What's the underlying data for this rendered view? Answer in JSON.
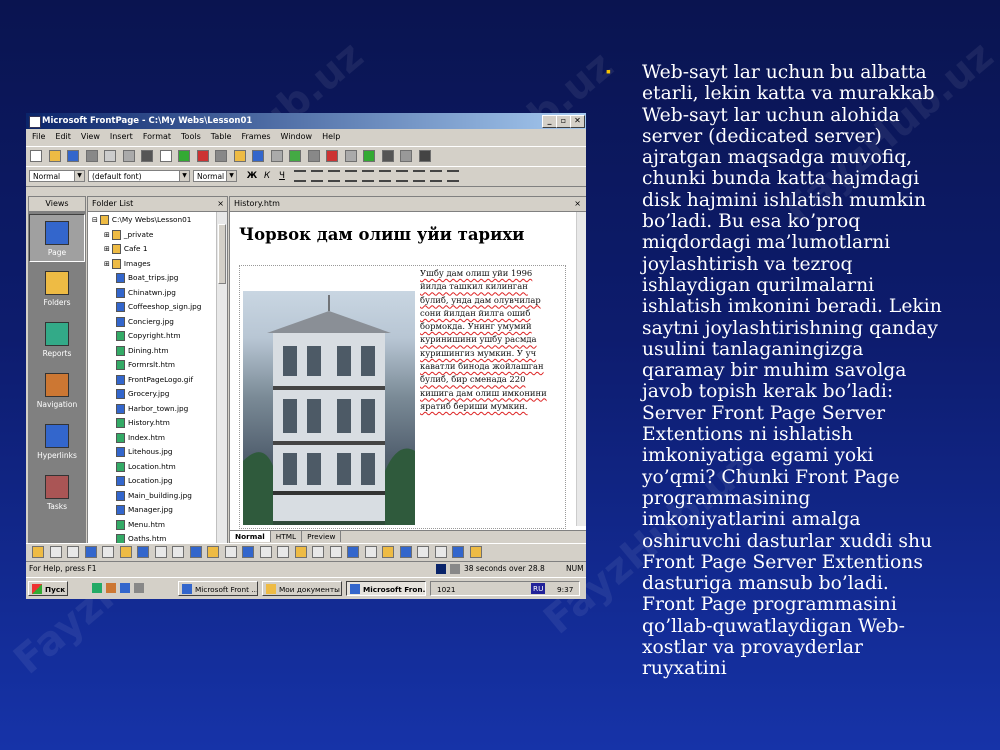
{
  "window": {
    "title": "Microsoft FrontPage - C:\\My Webs\\Lesson01",
    "controls": [
      "_",
      "▫",
      "✕"
    ]
  },
  "menu": [
    "File",
    "Edit",
    "View",
    "Insert",
    "Format",
    "Tools",
    "Table",
    "Frames",
    "Window",
    "Help"
  ],
  "format_toolbar": {
    "style": "Normal",
    "font": "(default font)",
    "size": "Normal",
    "bold": "Ж",
    "italic": "К",
    "underline": "Ч"
  },
  "views_panel": {
    "title": "Views",
    "items": [
      "Page",
      "Folders",
      "Reports",
      "Navigation",
      "Hyperlinks",
      "Tasks"
    ]
  },
  "folder_list": {
    "title": "Folder List",
    "close": "×",
    "items": [
      {
        "label": "C:\\My Webs\\Lesson01",
        "kind": "root"
      },
      {
        "label": "_private",
        "kind": "folder"
      },
      {
        "label": "Cafe 1",
        "kind": "folder"
      },
      {
        "label": "Images",
        "kind": "folder"
      },
      {
        "label": "Boat_trips.jpg",
        "kind": "image"
      },
      {
        "label": "Chinatwn.jpg",
        "kind": "image"
      },
      {
        "label": "Coffeeshop_sign.jpg",
        "kind": "image"
      },
      {
        "label": "Concierg.jpg",
        "kind": "image"
      },
      {
        "label": "Copyright.htm",
        "kind": "page"
      },
      {
        "label": "Dining.htm",
        "kind": "page"
      },
      {
        "label": "Formrslt.htm",
        "kind": "page"
      },
      {
        "label": "FrontPageLogo.gif",
        "kind": "image"
      },
      {
        "label": "Grocery.jpg",
        "kind": "image"
      },
      {
        "label": "Harbor_town.jpg",
        "kind": "image"
      },
      {
        "label": "History.htm",
        "kind": "page"
      },
      {
        "label": "Index.htm",
        "kind": "page"
      },
      {
        "label": "Litehous.jpg",
        "kind": "image"
      },
      {
        "label": "Location.htm",
        "kind": "page"
      },
      {
        "label": "Location.jpg",
        "kind": "image"
      },
      {
        "label": "Main_building.jpg",
        "kind": "image"
      },
      {
        "label": "Manager.jpg",
        "kind": "image"
      },
      {
        "label": "Menu.htm",
        "kind": "page"
      },
      {
        "label": "Oaths.htm",
        "kind": "page"
      }
    ]
  },
  "editor": {
    "tab": "History.htm",
    "close": "×",
    "heading": "Чорвок дам олиш уйи тарихи",
    "body_lines": [
      "Ушбу дам олиш уйи 1996",
      "йилда ташкил килинган",
      "булиб, унда дам олувчилар",
      "сони йилдан йилга ошиб",
      "бормокда. Унинг умумий",
      "куринишини ушбу расмда",
      "куришингиз мумкин. У уч",
      "каватли бинода жойлашган",
      "булиб, бир сменада 220",
      "кишига дам олиш имконини",
      "яратиб бериши мумкин."
    ],
    "modes": [
      "Normal",
      "HTML",
      "Preview"
    ],
    "active_mode": "Normal"
  },
  "status": {
    "help": "For Help, press F1",
    "timing": "38 seconds over 28.8",
    "num": "NUM"
  },
  "taskbar": {
    "start": "Пуск",
    "tasks": [
      "Microsoft Front ...",
      "Мои документы",
      "Microsoft Fron..."
    ],
    "number": "1021",
    "lang": "RU",
    "clock": "9:37"
  },
  "slide_text": "Web-sayt lar uchun bu albatta etarli, lekin katta va murakkab Web-sayt lar uchun alohida server (dedicated server) ajratgan maqsadga muvofiq, chunki bunda katta hajmdagi disk hajmini ishlatish mumkin bo’ladi. Bu esa ko’proq miqdordagi ma’lumotlarni joylashtirish va tezroq ishlaydigan qurilmalarni ishlatish imkonini beradi. Lekin saytni joylashtirishning qanday usulini tanlaganingizga qaramay bir muhim savolga javob topish kerak bo’ladi: Server Front Page Server Extentions ni ishlatish imkoniyatiga egami yoki yo’qmi? Chunki Front Page programmasining imkoniyatlarini amalga oshiruvchi dasturlar xuddi shu Front Page Server Extentions dasturiga mansub bo’ladi. Front Page programmasini qo’llab-quwatlaydigan Web-xostlar va provayderlar ruyxatini",
  "bullet": "▪",
  "colors": {
    "bg_top": "#0a1450",
    "bg_bottom": "#1633a8",
    "bullet": "#f7c200",
    "titlebar": "#0a246a"
  }
}
